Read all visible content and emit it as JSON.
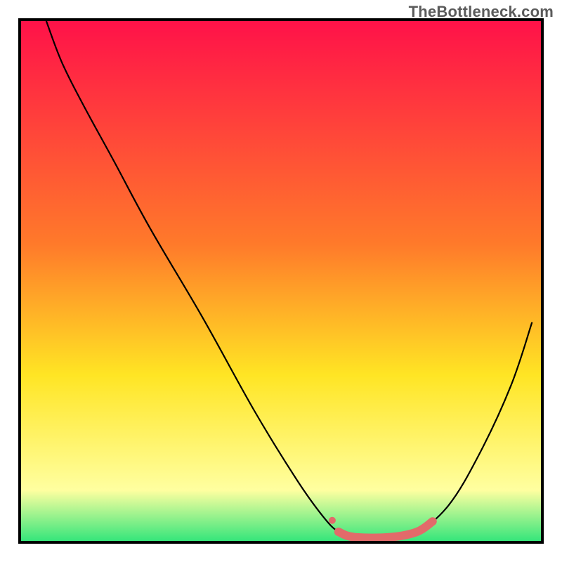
{
  "watermark": "TheBottleneck.com",
  "chart_data": {
    "type": "line",
    "title": "",
    "xlabel": "",
    "ylabel": "",
    "xlim": [
      0,
      100
    ],
    "ylim": [
      0,
      100
    ],
    "grid": false,
    "colors": {
      "gradient_top": "#ff1149",
      "gradient_orange": "#ff7a2a",
      "gradient_yellow": "#ffe524",
      "gradient_pale_yellow": "#ffffa0",
      "gradient_bottom": "#30e57a",
      "curve": "#000000",
      "highlight": "#e26a6a",
      "frame": "#000000"
    },
    "series": [
      {
        "name": "bottleneck-curve",
        "x": [
          5,
          8,
          12,
          18,
          25,
          35,
          45,
          53,
          58,
          61,
          64,
          71,
          76,
          82,
          88,
          94,
          98
        ],
        "y": [
          100,
          92,
          84,
          73,
          60,
          43,
          25,
          12,
          5,
          2,
          1,
          1,
          2,
          7,
          17,
          30,
          42
        ],
        "color": "#000000"
      },
      {
        "name": "highlight-band",
        "x": [
          61,
          64,
          71,
          76,
          79
        ],
        "y": [
          2,
          1,
          1,
          2,
          4
        ],
        "color": "#e26a6a"
      }
    ],
    "annotations": []
  }
}
